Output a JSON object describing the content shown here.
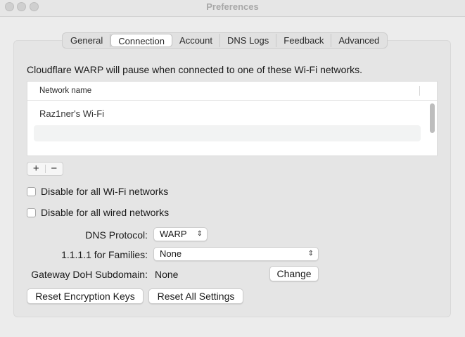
{
  "window": {
    "title": "Preferences"
  },
  "tabs": [
    {
      "label": "General"
    },
    {
      "label": "Connection"
    },
    {
      "label": "Account"
    },
    {
      "label": "DNS Logs"
    },
    {
      "label": "Feedback"
    },
    {
      "label": "Advanced"
    }
  ],
  "active_tab": "Connection",
  "intro_text": "Cloudflare WARP will pause when connected to one of these Wi-Fi networks.",
  "networks_table": {
    "column_header": "Network name",
    "rows": [
      {
        "name": "Raz1ner's Wi-Fi"
      }
    ]
  },
  "table_controls": {
    "add_label": "+",
    "remove_label": "−"
  },
  "checkboxes": {
    "disable_wifi": {
      "label": "Disable for all Wi-Fi networks",
      "checked": false
    },
    "disable_wired": {
      "label": "Disable for all wired networks",
      "checked": false
    }
  },
  "dns_protocol": {
    "label": "DNS Protocol:",
    "value": "WARP"
  },
  "families": {
    "label": "1.1.1.1 for Families:",
    "value": "None"
  },
  "gateway": {
    "label": "Gateway DoH Subdomain:",
    "value": "None",
    "change_label": "Change"
  },
  "buttons": {
    "reset_keys": "Reset Encryption Keys",
    "reset_all": "Reset All Settings"
  },
  "icons": {
    "window_controls": [
      "close-icon",
      "minimize-icon",
      "zoom-icon"
    ],
    "popup_chevron": "updown-chevron-icon"
  }
}
